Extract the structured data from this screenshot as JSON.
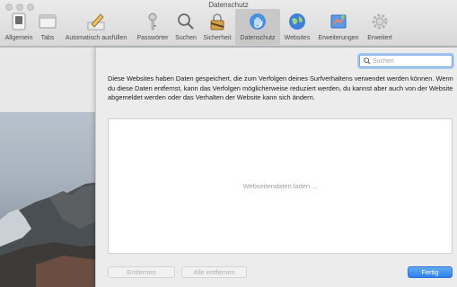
{
  "window": {
    "title": "Datenschutz"
  },
  "toolbar": {
    "items": [
      {
        "label": "Allgemein",
        "icon": "general-switch-icon"
      },
      {
        "label": "Tabs",
        "icon": "tabs-icon"
      },
      {
        "label": "Automatisch ausfüllen",
        "icon": "autofill-pencil-icon"
      },
      {
        "label": "Passwörter",
        "icon": "key-icon"
      },
      {
        "label": "Suchen",
        "icon": "magnifier-icon"
      },
      {
        "label": "Sicherheit",
        "icon": "lock-icon"
      },
      {
        "label": "Datenschutz",
        "icon": "privacy-hand-icon",
        "selected": true
      },
      {
        "label": "Websites",
        "icon": "globe-icon"
      },
      {
        "label": "Erweiterungen",
        "icon": "puzzle-icon"
      },
      {
        "label": "Erweitert",
        "icon": "gear-icon"
      }
    ]
  },
  "sheet": {
    "search": {
      "placeholder": "Suchen",
      "value": ""
    },
    "description": "Diese Websites haben Daten gespeichert, die zum Verfolgen deines Surfverhaltens verwendet werden können. Wenn du diese Daten entfernst, kann das Verfolgen möglicherweise reduziert werden, du kannst aber auch von der Website abgemeldet werden oder das Verhalten der Website kann sich ändern.",
    "loading_text": "Webseitendaten laden ...",
    "buttons": {
      "remove": "Entfernen",
      "remove_all": "Alle entfernen",
      "done": "Fertig"
    }
  },
  "colors": {
    "accent": "#3a86ee",
    "selected_tab": "#c9c8c9"
  }
}
